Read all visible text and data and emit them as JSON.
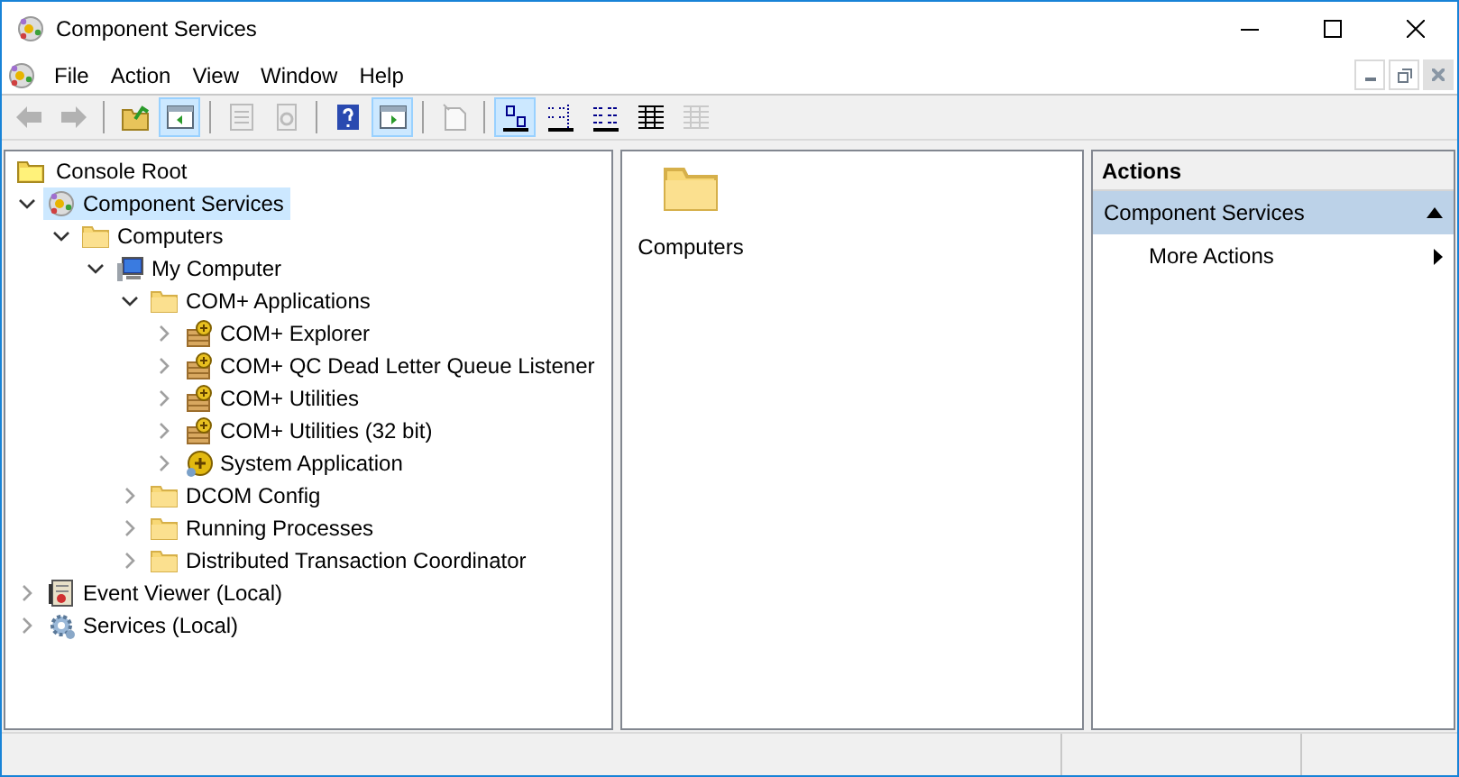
{
  "window": {
    "title": "Component Services"
  },
  "menu": [
    {
      "label": "File"
    },
    {
      "label": "Action"
    },
    {
      "label": "View"
    },
    {
      "label": "Window"
    },
    {
      "label": "Help"
    }
  ],
  "toolbar": [
    {
      "kind": "back",
      "disabled": true,
      "pressed": false
    },
    {
      "kind": "forward",
      "disabled": true,
      "pressed": false
    },
    {
      "kind": "sep"
    },
    {
      "kind": "up",
      "disabled": false,
      "pressed": false
    },
    {
      "kind": "tree-toggle",
      "disabled": false,
      "pressed": true
    },
    {
      "kind": "sep"
    },
    {
      "kind": "export",
      "disabled": true,
      "pressed": false
    },
    {
      "kind": "refresh",
      "disabled": true,
      "pressed": false
    },
    {
      "kind": "sep"
    },
    {
      "kind": "help",
      "disabled": false,
      "pressed": false
    },
    {
      "kind": "action-toggle",
      "disabled": false,
      "pressed": true
    },
    {
      "kind": "sep"
    },
    {
      "kind": "new",
      "disabled": true,
      "pressed": false
    },
    {
      "kind": "sep"
    },
    {
      "kind": "large-icons",
      "disabled": false,
      "pressed": true
    },
    {
      "kind": "small-icons",
      "disabled": false,
      "pressed": false
    },
    {
      "kind": "list",
      "disabled": false,
      "pressed": false
    },
    {
      "kind": "details",
      "disabled": false,
      "pressed": false
    },
    {
      "kind": "details",
      "disabled": true,
      "pressed": false
    }
  ],
  "tree": {
    "label": "Console Root",
    "kind": "root",
    "children": [
      {
        "label": "Component Services",
        "kind": "services",
        "expanded": true,
        "selected": true,
        "children": [
          {
            "label": "Computers",
            "kind": "folder",
            "expanded": true,
            "selected": false,
            "children": [
              {
                "label": "My Computer",
                "kind": "computer",
                "expanded": true,
                "selected": false,
                "children": [
                  {
                    "label": "COM+ Applications",
                    "kind": "folder",
                    "expanded": true,
                    "selected": false,
                    "children": [
                      {
                        "label": "COM+ Explorer",
                        "kind": "package",
                        "expanded": false,
                        "selected": false
                      },
                      {
                        "label": "COM+ QC Dead Letter Queue Listener",
                        "kind": "package",
                        "expanded": false,
                        "selected": false
                      },
                      {
                        "label": "COM+ Utilities",
                        "kind": "package",
                        "expanded": false,
                        "selected": false
                      },
                      {
                        "label": "COM+ Utilities (32 bit)",
                        "kind": "package",
                        "expanded": false,
                        "selected": false
                      },
                      {
                        "label": "System Application",
                        "kind": "system",
                        "expanded": false,
                        "selected": false
                      }
                    ]
                  },
                  {
                    "label": "DCOM Config",
                    "kind": "folder",
                    "expanded": false,
                    "selected": false
                  },
                  {
                    "label": "Running Processes",
                    "kind": "folder",
                    "expanded": false,
                    "selected": false
                  },
                  {
                    "label": "Distributed Transaction Coordinator",
                    "kind": "folder",
                    "expanded": false,
                    "selected": false
                  }
                ]
              }
            ]
          }
        ]
      },
      {
        "label": "Event Viewer (Local)",
        "kind": "event",
        "expanded": false,
        "selected": false
      },
      {
        "label": "Services (Local)",
        "kind": "gear",
        "expanded": false,
        "selected": false
      }
    ]
  },
  "content": [
    {
      "label": "Computers"
    }
  ],
  "actions": {
    "title": "Actions",
    "sections": [
      {
        "title": "Component Services",
        "expanded": true,
        "items": [
          {
            "label": "More Actions"
          }
        ]
      }
    ]
  }
}
